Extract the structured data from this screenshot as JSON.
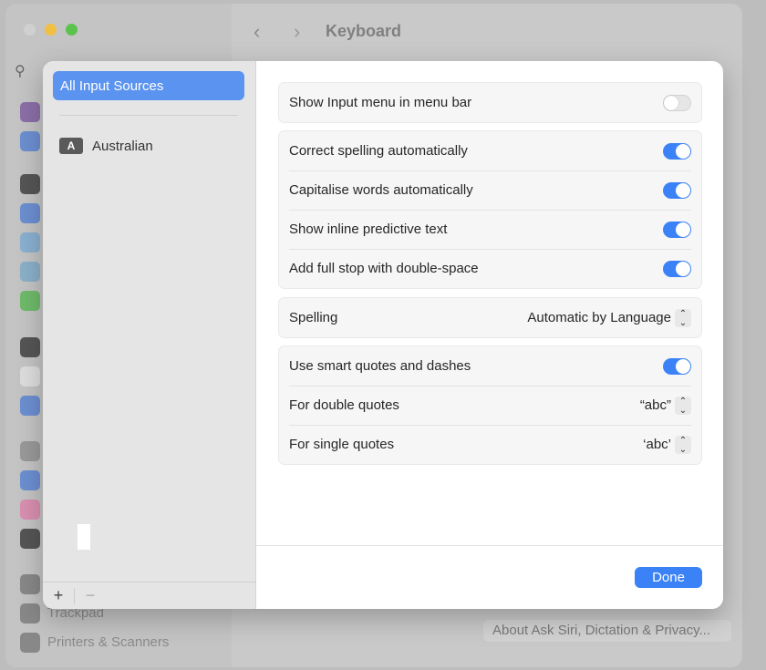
{
  "window": {
    "title": "Keyboard",
    "back": "‹",
    "forward": "›",
    "bg_sidebar": [
      "Trackpad",
      "Printers & Scanners"
    ],
    "about_button": "About Ask Siri, Dictation & Privacy..."
  },
  "sheet": {
    "sources": {
      "selected": "All Input Sources",
      "items": [
        {
          "badge": "A",
          "label": "Australian"
        }
      ],
      "add": "+",
      "remove": "−"
    },
    "groups": [
      [
        {
          "label": "Show Input menu in menu bar",
          "type": "toggle",
          "on": false
        }
      ],
      [
        {
          "label": "Correct spelling automatically",
          "type": "toggle",
          "on": true
        },
        {
          "label": "Capitalise words automatically",
          "type": "toggle",
          "on": true
        },
        {
          "label": "Show inline predictive text",
          "type": "toggle",
          "on": true
        },
        {
          "label": "Add full stop with double-space",
          "type": "toggle",
          "on": true
        }
      ],
      [
        {
          "label": "Spelling",
          "type": "popup",
          "value": "Automatic by Language"
        }
      ],
      [
        {
          "label": "Use smart quotes and dashes",
          "type": "toggle",
          "on": true
        },
        {
          "label": "For double quotes",
          "type": "popup",
          "value": "“abc”"
        },
        {
          "label": "For single quotes",
          "type": "popup",
          "value": "‘abc’"
        }
      ]
    ],
    "done": "Done"
  },
  "colors": {
    "accent": "#3b82f6",
    "selection": "#5b93f0"
  }
}
